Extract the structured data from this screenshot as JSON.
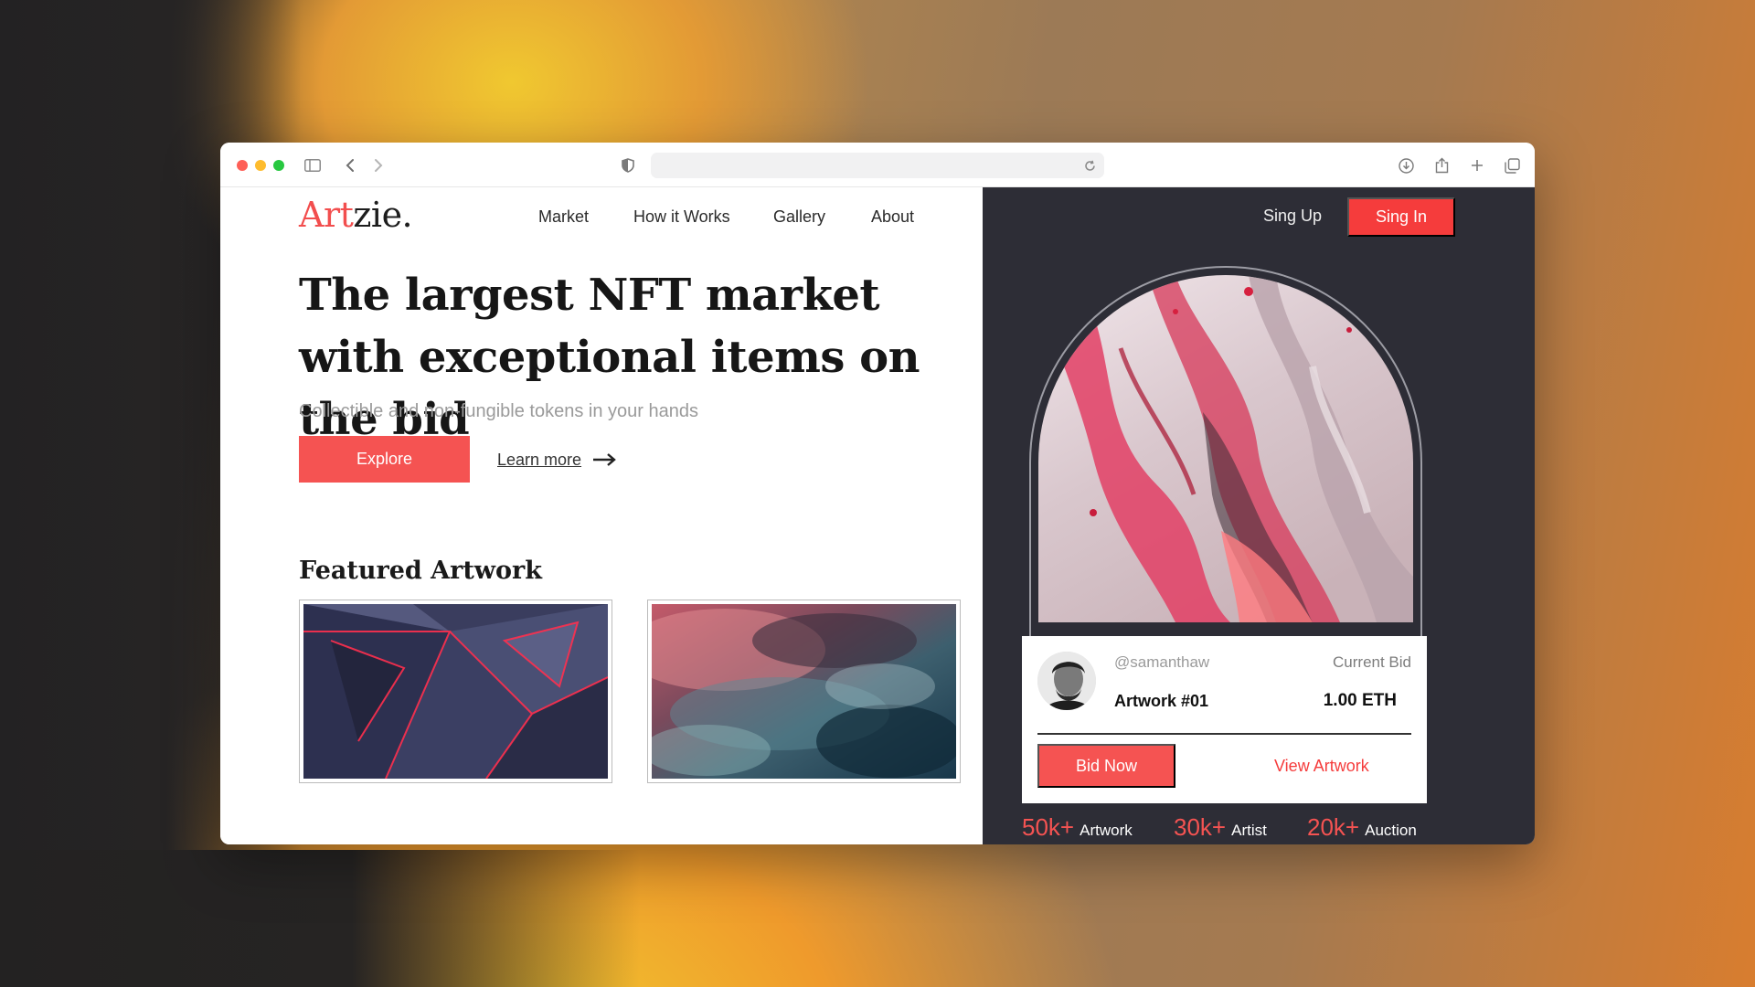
{
  "browser": {
    "toolbar_icons": [
      "sidebar-icon",
      "back-icon",
      "forward-icon",
      "shield-icon",
      "reload-icon",
      "download-icon",
      "share-icon",
      "new-tab-icon",
      "tabs-overview-icon"
    ]
  },
  "site": {
    "logo": {
      "accent": "Art",
      "rest": "zie."
    },
    "nav": [
      "Market",
      "How it Works",
      "Gallery",
      "About"
    ],
    "auth": {
      "signup": "Sing Up",
      "signin": "Sing In"
    },
    "hero": {
      "title": "The largest NFT market with exceptional items on the bid",
      "subtitle": "Collectible and non-fungible tokens in your hands",
      "explore": "Explore",
      "learn_more": "Learn more"
    },
    "featured": {
      "heading": "Featured Artwork"
    },
    "card": {
      "handle": "@samanthaw",
      "current_bid_label": "Current Bid",
      "artwork_name": "Artwork #01",
      "bid_value": "1.00 ETH",
      "bid_now": "Bid Now",
      "view_artwork": "View Artwork"
    },
    "stats": [
      {
        "value": "50k+",
        "label": "Artwork"
      },
      {
        "value": "30k+",
        "label": "Artist"
      },
      {
        "value": "20k+",
        "label": "Auction"
      }
    ],
    "colors": {
      "accent": "#f55352",
      "dark_panel": "#2d2d36"
    }
  }
}
